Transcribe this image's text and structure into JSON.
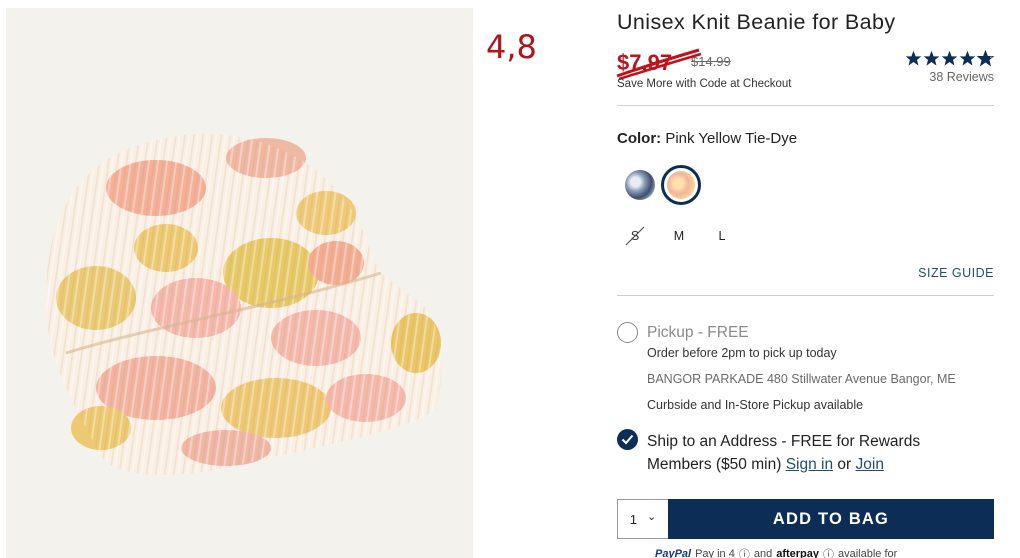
{
  "product": {
    "title": "Unisex Knit Beanie for Baby",
    "sale_price": "$7.97",
    "original_price": "$14.99",
    "promo": "Save More with Code at Checkout",
    "rating_value": 4.8,
    "reviews": "38 Reviews"
  },
  "annotation": "4,8",
  "color": {
    "label": "Color:",
    "value": "Pink Yellow Tie-Dye",
    "swatches": [
      {
        "name": "blue-tie-dye",
        "selected": false
      },
      {
        "name": "pink-yellow-tie-dye",
        "selected": true
      }
    ]
  },
  "sizes": [
    {
      "label": "S",
      "available": false
    },
    {
      "label": "M",
      "available": true
    },
    {
      "label": "L",
      "available": true
    }
  ],
  "size_guide": "SIZE GUIDE",
  "pickup": {
    "title": "Pickup - FREE",
    "order_before": "Order before 2pm to pick up today",
    "store_name": "BANGOR PARKADE",
    "store_address": "480 Stillwater Avenue",
    "store_city": "Bangor, ME",
    "curbside": "Curbside and In-Store Pickup available",
    "selected": false
  },
  "ship": {
    "text": "Ship to an Address - FREE for Rewards Members ($50 min)",
    "sign_in": "Sign in",
    "or": "or",
    "join": "Join",
    "selected": true
  },
  "cart": {
    "quantity": "1",
    "quantity_caret": "⌄",
    "add_label": "ADD TO BAG"
  },
  "payment": {
    "paypal": "PayPal",
    "paypal_text": "Pay in 4",
    "and": "and",
    "afterpay": "afterpay",
    "available": "available for"
  },
  "colors": {
    "navy": "#0c2e56",
    "sale_red": "#c0121a",
    "link_blue": "#1f4d7a"
  }
}
